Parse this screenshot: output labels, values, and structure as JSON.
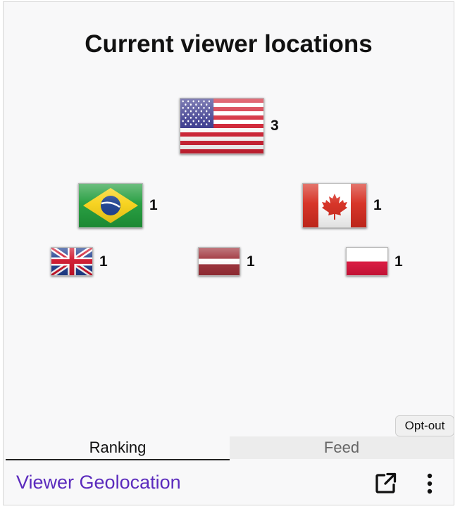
{
  "widget": {
    "title": "Current viewer locations",
    "optout_label": "Opt-out",
    "footer_title": "Viewer Geolocation"
  },
  "locations": [
    {
      "country": "United States",
      "count": "3"
    },
    {
      "country": "Brazil",
      "count": "1"
    },
    {
      "country": "Canada",
      "count": "1"
    },
    {
      "country": "United Kingdom",
      "count": "1"
    },
    {
      "country": "Latvia",
      "count": "1"
    },
    {
      "country": "Poland",
      "count": "1"
    }
  ],
  "tabs": [
    {
      "label": "Ranking",
      "active": true
    },
    {
      "label": "Feed",
      "active": false
    }
  ],
  "icons": [
    "external-link-icon",
    "more-vertical-icon"
  ],
  "colors": {
    "link": "#5b2bbd",
    "panel": "#f8f8f9"
  }
}
